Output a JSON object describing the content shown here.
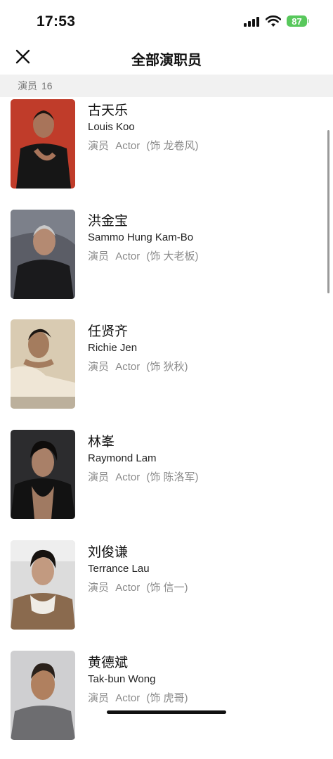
{
  "status_bar": {
    "time": "17:53",
    "battery": "87"
  },
  "header": {
    "title": "全部演职员"
  },
  "section": {
    "label": "演员",
    "count": "16"
  },
  "cast": [
    {
      "name_cn": "古天乐",
      "name_en": "Louis Koo",
      "role_cn": "演员",
      "role_en": "Actor",
      "character": "(饰 龙卷风)"
    },
    {
      "name_cn": "洪金宝",
      "name_en": "Sammo Hung Kam-Bo",
      "role_cn": "演员",
      "role_en": "Actor",
      "character": "(饰 大老板)"
    },
    {
      "name_cn": "任贤齐",
      "name_en": "Richie Jen",
      "role_cn": "演员",
      "role_en": "Actor",
      "character": "(饰 狄秋)"
    },
    {
      "name_cn": "林峯",
      "name_en": "Raymond Lam",
      "role_cn": "演员",
      "role_en": "Actor",
      "character": "(饰 陈洛军)"
    },
    {
      "name_cn": "刘俊谦",
      "name_en": "Terrance Lau",
      "role_cn": "演员",
      "role_en": "Actor",
      "character": "(饰 信一)"
    },
    {
      "name_cn": "黄德斌",
      "name_en": "Tak-bun Wong",
      "role_cn": "演员",
      "role_en": "Actor",
      "character": "(饰 虎哥)"
    }
  ]
}
